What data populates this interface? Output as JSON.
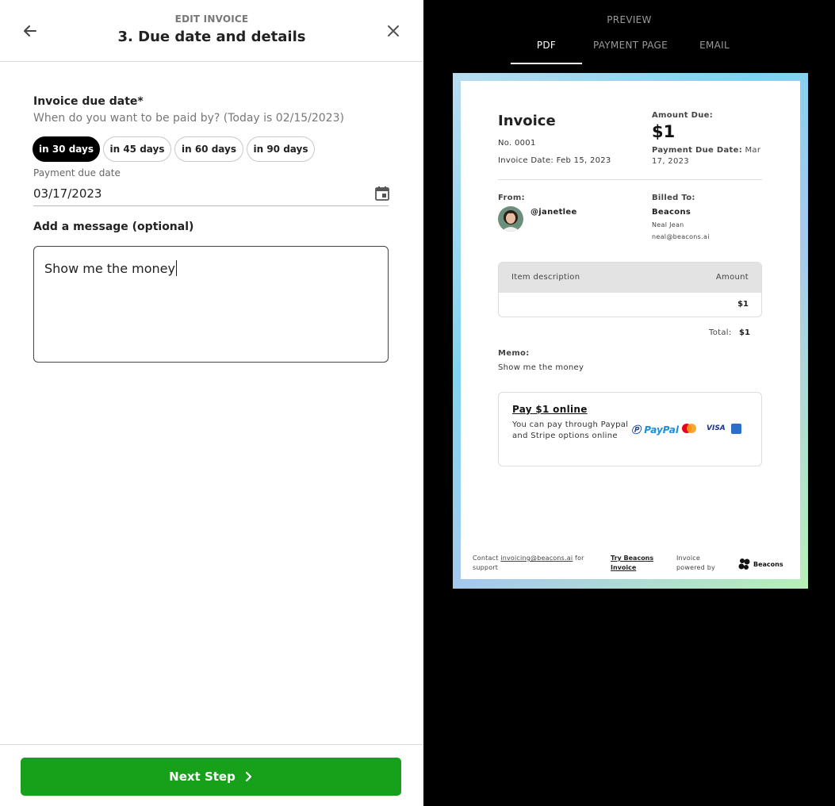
{
  "editor": {
    "header_subtitle": "EDIT INVOICE",
    "header_title": "3. Due date and details",
    "due_label": "Invoice due date*",
    "due_hint": "When do you want to be paid by? (Today is 02/15/2023)",
    "options": [
      "in 30 days",
      "in 45 days",
      "in 60 days",
      "in 90 days"
    ],
    "selected_option": "in 30 days",
    "payment_due_label": "Payment due date",
    "payment_due_value": "03/17/2023",
    "message_label": "Add a message (optional)",
    "message_value": "Show me the money",
    "next_button": "Next Step"
  },
  "preview": {
    "label": "PREVIEW",
    "tabs": [
      "PDF",
      "PAYMENT PAGE",
      "EMAIL"
    ],
    "active_tab": "PDF",
    "invoice": {
      "title": "Invoice",
      "number": "No. 0001",
      "invoice_date": "Invoice Date: Feb 15, 2023",
      "amount_due_label": "Amount Due:",
      "amount_due": "$1",
      "payment_due_label": "Payment Due Date:",
      "payment_due_value": "Mar 17, 2023",
      "from_label": "From:",
      "from_handle": "@janetlee",
      "billed_label": "Billed To:",
      "billed_company": "Beacons",
      "billed_name": "Neal Jean",
      "billed_email": "neal@beacons.ai",
      "table_header_desc": "Item description",
      "table_header_amount": "Amount",
      "row_amount": "$1",
      "total_label": "Total:",
      "total_value": "$1",
      "memo_label": "Memo:",
      "memo_value": "Show me the money",
      "pay_title": "Pay $1 online",
      "pay_desc": "You can pay through Paypal and Stripe options online",
      "paypal_text_1": "Pay",
      "paypal_text_2": "Pal",
      "visa_text": "VISA",
      "footer_contact_pre": "Contact",
      "footer_contact_email": "invoicing@beacons.ai",
      "footer_contact_post": "for support",
      "footer_try": "Try Beacons Invoice",
      "footer_powered": "Invoice powered by",
      "footer_brand": "Beacons"
    }
  },
  "colors": {
    "primary_green": "#17a11b",
    "active_pill": "#000000"
  }
}
